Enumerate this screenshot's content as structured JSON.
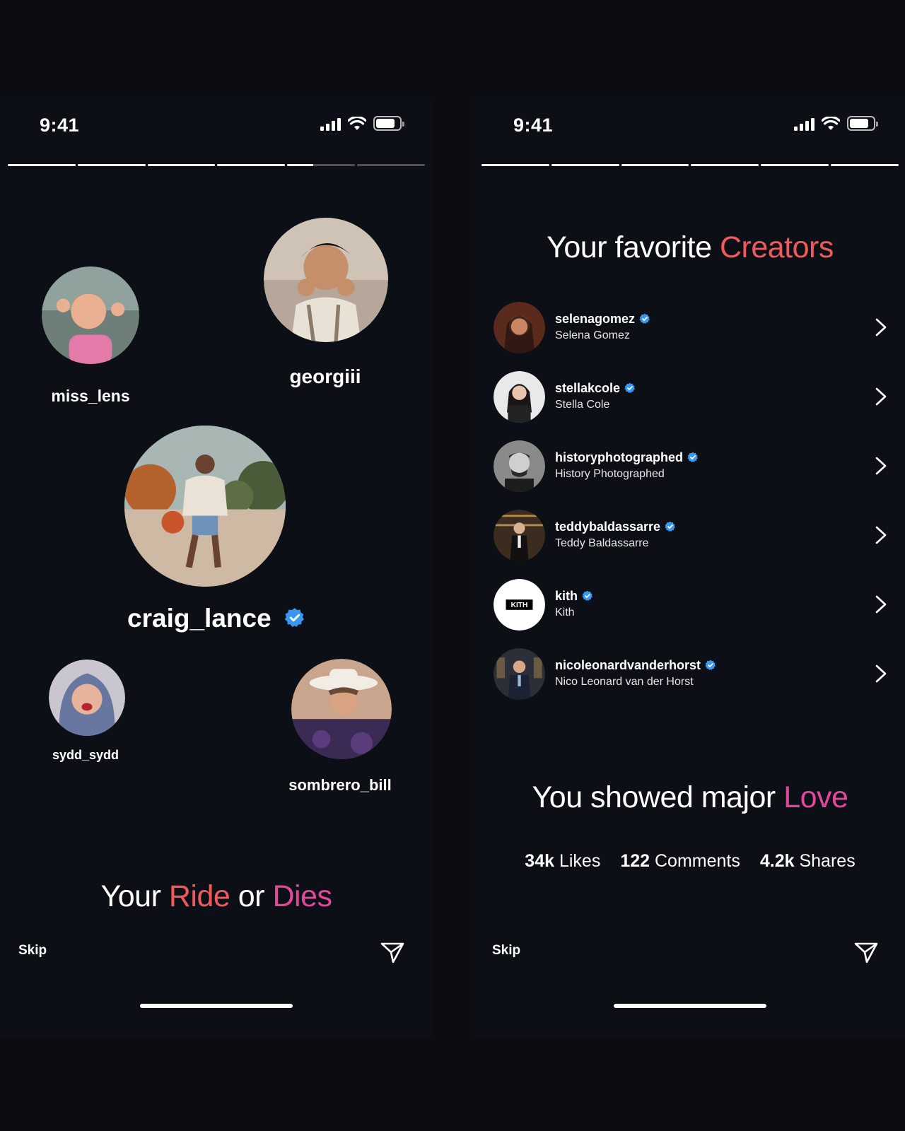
{
  "left": {
    "status_time": "9:41",
    "progress": [
      1,
      1,
      1,
      1,
      0.38,
      0
    ],
    "bubbles": {
      "miss_lens": "miss_lens",
      "georgiii": "georgiii",
      "craig_lance": "craig_lance",
      "sydd_sydd": "sydd_sydd",
      "sombrero_bill": "sombrero_bill"
    },
    "headline": {
      "w1": "Your ",
      "w2": "Ride",
      "w3": " or ",
      "w4": "Dies"
    },
    "skip": "Skip"
  },
  "right": {
    "status_time": "9:41",
    "progress": [
      1,
      1,
      1,
      1,
      1,
      1
    ],
    "headline": {
      "w1": "Your favorite ",
      "w2": "Creators"
    },
    "creators": [
      {
        "handle": "selenagomez",
        "name": "Selena Gomez"
      },
      {
        "handle": "stellakcole",
        "name": "Stella Cole"
      },
      {
        "handle": "historyphotographed",
        "name": "History Photographed"
      },
      {
        "handle": "teddybaldassarre",
        "name": "Teddy Baldassarre"
      },
      {
        "handle": "kith",
        "name": "Kith"
      },
      {
        "handle": "nicoleonardvanderhorst",
        "name": "Nico Leonard van der Horst"
      }
    ],
    "kith_logo": "KITH",
    "love_headline": {
      "w1": "You showed major ",
      "w2": "Love"
    },
    "stats": {
      "likes_value": "34k",
      "likes_label": " Likes",
      "comments_value": "122",
      "comments_label": " Comments",
      "shares_value": "4.2k",
      "shares_label": " Shares"
    },
    "skip": "Skip"
  },
  "colors": {
    "accent_orange": "#f15a5a",
    "accent_pink": "#e2489a",
    "verified_blue": "#3897f0",
    "background": "#0c0f16"
  }
}
